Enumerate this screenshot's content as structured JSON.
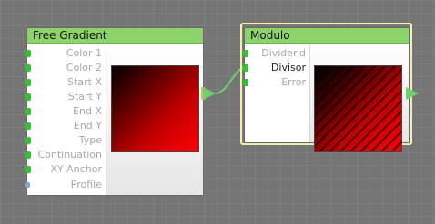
{
  "nodes": {
    "free_gradient": {
      "title": "Free Gradient",
      "inputs": [
        "Color 1",
        "Color 2",
        "Start X",
        "Start Y",
        "End X",
        "End Y",
        "Type",
        "Continuation",
        "XY Anchor",
        "Profile"
      ]
    },
    "modulo": {
      "title": "Modulo",
      "inputs": [
        "Dividend",
        "Divisor",
        "Error"
      ],
      "active_input": "Divisor"
    }
  },
  "colors": {
    "title_bar": "#8cd46a",
    "port_connected": "#34c034",
    "port_profile": "#7aa6e0",
    "selection_outline": "#f3f0ad",
    "connection": "#6fd06f",
    "canvas": "#757575"
  }
}
